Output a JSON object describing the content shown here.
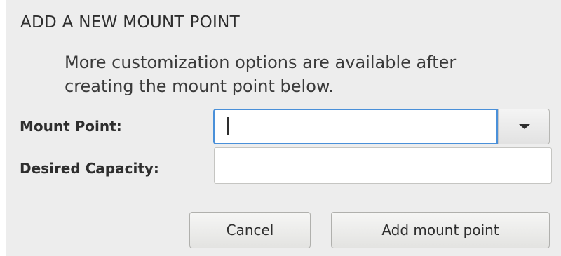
{
  "dialog": {
    "title": "ADD A NEW MOUNT POINT",
    "description": "More customization options are available after creating the mount point below.",
    "mount_point": {
      "label": "Mount Point:",
      "value": "",
      "dropdown_icon": "chevron-down-icon"
    },
    "desired_capacity": {
      "label": "Desired Capacity:",
      "value": ""
    },
    "buttons": {
      "cancel": "Cancel",
      "add": "Add mount point"
    }
  },
  "colors": {
    "background": "#ededed",
    "focus_border": "#4a90d9",
    "text": "#2e2e2e"
  }
}
